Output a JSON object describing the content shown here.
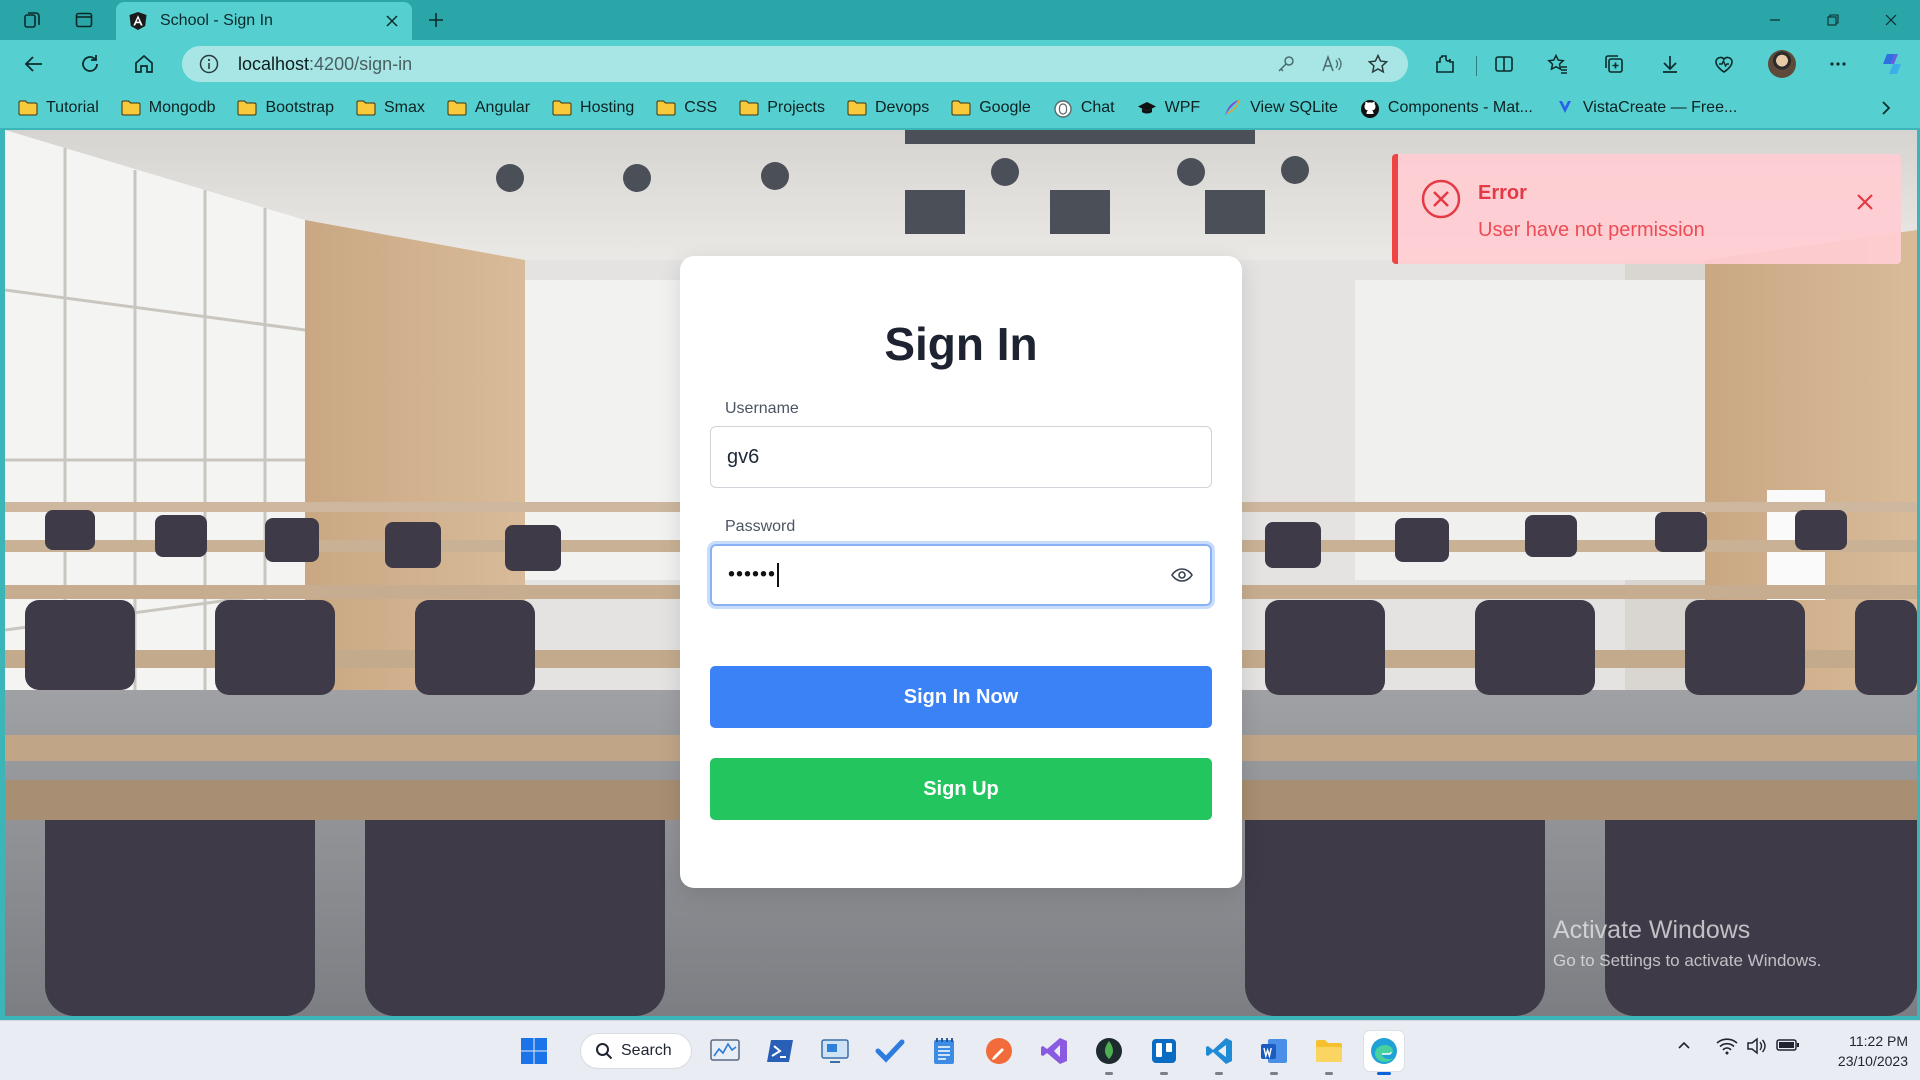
{
  "browser": {
    "tab": {
      "title": "School - Sign In"
    },
    "address": {
      "host": "localhost",
      "path": ":4200/sign-in"
    },
    "bookmarks": [
      {
        "label": "Tutorial",
        "icon": "folder-icon"
      },
      {
        "label": "Mongodb",
        "icon": "folder-icon"
      },
      {
        "label": "Bootstrap",
        "icon": "folder-icon"
      },
      {
        "label": "Smax",
        "icon": "folder-icon"
      },
      {
        "label": "Angular",
        "icon": "folder-icon"
      },
      {
        "label": "Hosting",
        "icon": "folder-icon"
      },
      {
        "label": "CSS",
        "icon": "folder-icon"
      },
      {
        "label": "Projects",
        "icon": "folder-icon"
      },
      {
        "label": "Devops",
        "icon": "folder-icon"
      },
      {
        "label": "Google",
        "icon": "folder-icon"
      },
      {
        "label": "Chat",
        "icon": "chat-icon"
      },
      {
        "label": "WPF",
        "icon": "graduation-cap-icon"
      },
      {
        "label": "View SQLite",
        "icon": "feather-icon"
      },
      {
        "label": "Components - Mat...",
        "icon": "github-icon"
      },
      {
        "label": "VistaCreate — Free...",
        "icon": "vistacreate-icon"
      }
    ]
  },
  "signin": {
    "title": "Sign In",
    "username_label": "Username",
    "username_value": "gv6",
    "password_label": "Password",
    "password_masked": "••••••",
    "signin_button": "Sign In Now",
    "signup_button": "Sign Up"
  },
  "toast": {
    "title": "Error",
    "message": "User have not permission"
  },
  "watermark": {
    "title": "Activate Windows",
    "subtitle": "Go to Settings to activate Windows."
  },
  "taskbar": {
    "search_label": "Search",
    "time": "11:22 PM",
    "date": "23/10/2023"
  },
  "colors": {
    "browser_frame": "#55cfd0",
    "primary_button": "#3b82f6",
    "success_button": "#22c55e",
    "error": "#ef4444"
  }
}
